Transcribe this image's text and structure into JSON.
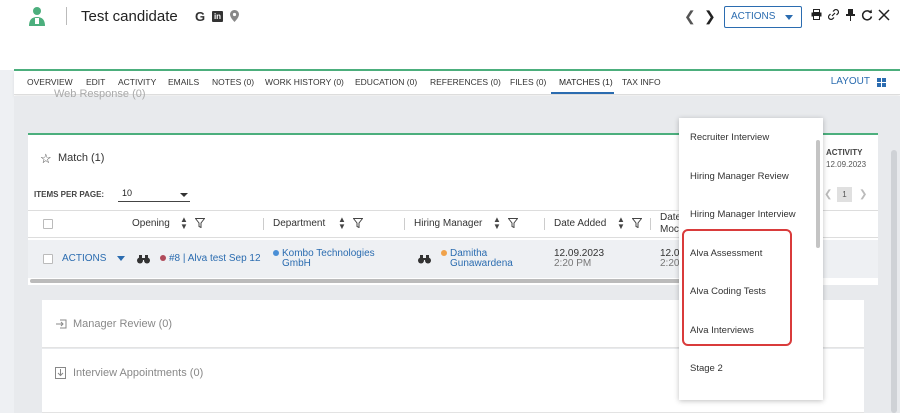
{
  "header": {
    "title": "Test candidate",
    "google_label": "G",
    "linkedin_label": "in",
    "actions_label": "ACTIONS"
  },
  "tabs": [
    {
      "label": "OVERVIEW"
    },
    {
      "label": "EDIT"
    },
    {
      "label": "ACTIVITY"
    },
    {
      "label": "EMAILS"
    },
    {
      "label": "NOTES (0)"
    },
    {
      "label": "WORK HISTORY (0)"
    },
    {
      "label": "EDUCATION (0)"
    },
    {
      "label": "REFERENCES (0)"
    },
    {
      "label": "FILES (0)"
    },
    {
      "label": "MATCHES (1)"
    },
    {
      "label": "TAX INFO"
    }
  ],
  "layout_label": "LAYOUT",
  "web_response": "Web Response (0)",
  "match": {
    "title": "Match (1)",
    "items_per_page_label": "ITEMS PER PAGE:",
    "items_per_page_value": "10",
    "activity_label": "ACTIVITY",
    "activity_date": "12.09.2023",
    "page_number": "1",
    "columns": {
      "opening": "Opening",
      "department": "Department",
      "hiring_manager": "Hiring Manager",
      "date_added": "Date Added",
      "date_mod_1": "Date",
      "date_mod_2": "Moc"
    },
    "row": {
      "actions": "ACTIONS",
      "opening": "#8 | Alva test Sep 12",
      "department_1": "Kombo Technologies",
      "department_2": "GmbH",
      "manager_1": "Damitha",
      "manager_2": "Gunawardena",
      "date_added_1": "12.09.2023",
      "date_added_2": "2:20 PM",
      "date_mod_1": "12.0",
      "date_mod_2": "2:20"
    }
  },
  "sections": {
    "manager_review": "Manager Review (0)",
    "interview_appointments": "Interview Appointments (0)"
  },
  "dropdown": {
    "items": [
      {
        "label": "Recruiter Interview"
      },
      {
        "label": "Hiring Manager Review"
      },
      {
        "label": "Hiring Manager Interview"
      },
      {
        "label": "Alva Assessment"
      },
      {
        "label": "Alva Coding Tests"
      },
      {
        "label": "Alva Interviews"
      },
      {
        "label": "Stage 2"
      }
    ]
  },
  "colors": {
    "accent": "#2b6cb0",
    "brand_green": "#4caf7d",
    "highlight": "#d93b3b",
    "opening_dot": "#b04a5a",
    "department_dot": "#4a8fd6",
    "manager_dot": "#f0a24a"
  }
}
